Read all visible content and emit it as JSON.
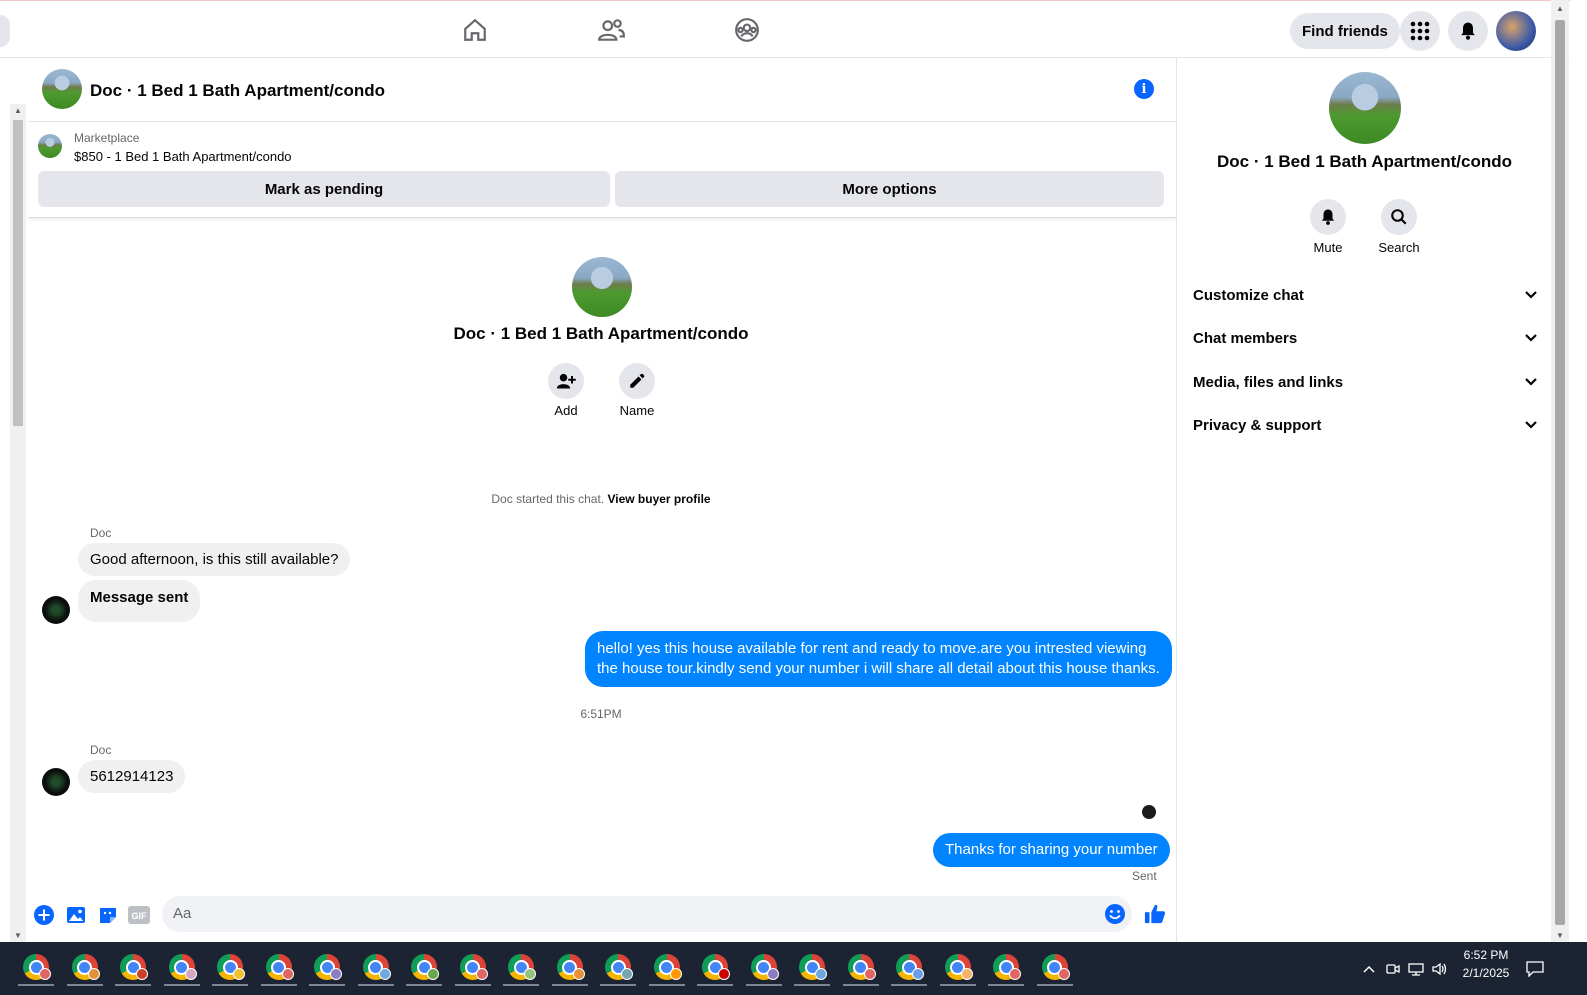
{
  "topbar": {
    "find_friends": "Find friends"
  },
  "chat": {
    "title": "Doc · 1 Bed 1 Bath Apartment/condo",
    "marketplace_label": "Marketplace",
    "listing": "$850 - 1 Bed 1 Bath Apartment/condo",
    "mark_pending": "Mark as pending",
    "more_options": "More options",
    "intro_title": "Doc · 1 Bed 1 Bath Apartment/condo",
    "add_label": "Add",
    "name_label": "Name",
    "started_text": "Doc started this chat.",
    "view_buyer": "View buyer profile",
    "timestamp": "6:51PM",
    "sent_status": "Sent",
    "composer_placeholder": "Aa"
  },
  "messages": [
    {
      "sender": "Doc",
      "text": "Good afternoon, is this still available?"
    },
    {
      "text": "Message sent"
    },
    {
      "text_line1": "hello! yes this house available for rent and ready to move.are you intrested viewing",
      "text_line2": "the house tour.kindly send your number i will share all detail about this house thanks."
    },
    {
      "sender": "Doc",
      "text": "5612914123"
    },
    {
      "text": "Thanks for sharing your number"
    }
  ],
  "right_panel": {
    "title": "Doc · 1 Bed 1 Bath Apartment/condo",
    "mute": "Mute",
    "search": "Search",
    "sections": [
      "Customize chat",
      "Chat members",
      "Media, files and links",
      "Privacy & support"
    ]
  },
  "taskbar": {
    "time": "6:52 PM",
    "date": "2/1/2025"
  },
  "colors": {
    "accent": "#0084ff",
    "facebook_blue": "#0866ff"
  }
}
